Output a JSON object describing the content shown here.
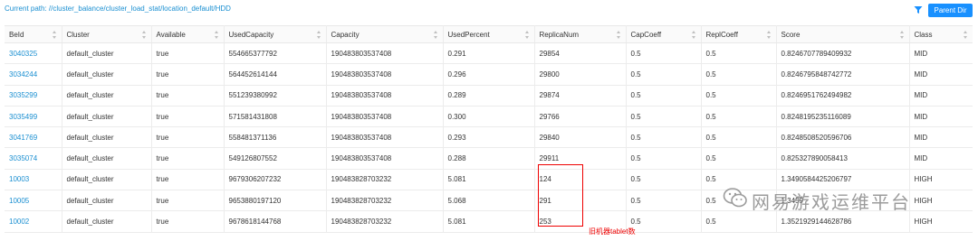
{
  "header": {
    "current_path": "Current path: //cluster_balance/cluster_load_stat/location_default/HDD",
    "parent_dir_label": "Parent Dir",
    "filter_icon": "filter-icon"
  },
  "table": {
    "columns": [
      "BeId",
      "Cluster",
      "Available",
      "UsedCapacity",
      "Capacity",
      "UsedPercent",
      "ReplicaNum",
      "CapCoeff",
      "ReplCoeff",
      "Score",
      "Class"
    ],
    "rows": [
      [
        "3040325",
        "default_cluster",
        "true",
        "554665377792",
        "190483803537408",
        "0.291",
        "29854",
        "0.5",
        "0.5",
        "0.8246707789409932",
        "MID"
      ],
      [
        "3034244",
        "default_cluster",
        "true",
        "564452614144",
        "190483803537408",
        "0.296",
        "29800",
        "0.5",
        "0.5",
        "0.8246795848742772",
        "MID"
      ],
      [
        "3035299",
        "default_cluster",
        "true",
        "551239380992",
        "190483803537408",
        "0.289",
        "29874",
        "0.5",
        "0.5",
        "0.8246951762494982",
        "MID"
      ],
      [
        "3035499",
        "default_cluster",
        "true",
        "571581431808",
        "190483803537408",
        "0.300",
        "29766",
        "0.5",
        "0.5",
        "0.8248195235116089",
        "MID"
      ],
      [
        "3041769",
        "default_cluster",
        "true",
        "558481371136",
        "190483803537408",
        "0.293",
        "29840",
        "0.5",
        "0.5",
        "0.8248508520596706",
        "MID"
      ],
      [
        "3035074",
        "default_cluster",
        "true",
        "549126807552",
        "190483803537408",
        "0.288",
        "29911",
        "0.5",
        "0.5",
        "0.825327890058413",
        "MID"
      ],
      [
        "10003",
        "default_cluster",
        "true",
        "9679306207232",
        "190483828703232",
        "5.081",
        "124",
        "0.5",
        "0.5",
        "1.3490584425206797",
        "HIGH"
      ],
      [
        "10005",
        "default_cluster",
        "true",
        "9653880197120",
        "190483828703232",
        "5.068",
        "291",
        "0.5",
        "0.5",
        "1.3459",
        "HIGH"
      ],
      [
        "10002",
        "default_cluster",
        "true",
        "9678618144768",
        "190483828703232",
        "5.081",
        "253",
        "0.5",
        "0.5",
        "1.3521929144628786",
        "HIGH"
      ]
    ]
  },
  "annotation": {
    "text": "旧机器tablet数",
    "color": "#ee0000"
  },
  "watermark": {
    "text": "网易游戏运维平台"
  },
  "colors": {
    "link": "#1a8fd1",
    "button": "#1890ff"
  }
}
